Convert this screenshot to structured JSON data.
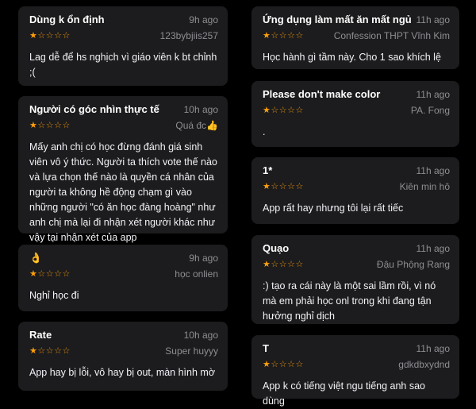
{
  "reviews_left": [
    {
      "title": "Dùng k ổn định",
      "time": "9h ago",
      "rating": 1,
      "author": "123bybjiis257",
      "body": "Lag dễ để hs nghịch vì giáo viên k bt chỉnh ;("
    },
    {
      "title": "Người có góc nhìn thực tế",
      "time": "10h ago",
      "rating": 1,
      "author": "Quá đc👍",
      "body": "Mấy anh chị có học đừng đánh giá sinh viên vô ý thức. Người ta thích vote thế nào và lựa chọn thế nào là quyền cá nhân của người ta không hề động chạm gì vào những người \"có ăn học đàng hoàng\" như anh chị mà lại đi nhận xét người khác như vậy tại nhận xét của app"
    },
    {
      "title": "👌",
      "time": "9h ago",
      "rating": 1,
      "author": "học onlien",
      "body": "Nghỉ học đi"
    },
    {
      "title": "Rate",
      "time": "10h ago",
      "rating": 1,
      "author": "Super huyyy",
      "body": "App hay bị lỗi, vô hay bị out, màn hình mờ"
    }
  ],
  "reviews_right": [
    {
      "title": "Ứng dụng làm mất ăn mất ngủ",
      "time": "11h ago",
      "rating": 1,
      "author": "Confession THPT Vĩnh Kim",
      "body": "Học hành gì tầm này. Cho 1 sao khích lệ"
    },
    {
      "title": "Please don't make color",
      "time": "11h ago",
      "rating": 1,
      "author": "PA. Fong",
      "body": "."
    },
    {
      "title": "1*",
      "time": "11h ago",
      "rating": 1,
      "author": "Kiên min hô",
      "body": "App rất hay nhưng tôi lại rất tiếc"
    },
    {
      "title": "Quạo",
      "time": "11h ago",
      "rating": 1,
      "author": "Đậu Phộng Rang",
      "body": ":) tạo ra cái này là một sai lầm rồi, vì nó mà em phải học onl trong khi đang tận hưởng nghỉ dịch"
    },
    {
      "title": "T",
      "time": "11h ago",
      "rating": 1,
      "author": "gdkdbxydnd",
      "body": "App k có tiếng việt ngu tiếng anh sao dùng"
    }
  ],
  "rating_max": 5,
  "colors": {
    "star": "#ff9f0a",
    "card": "#1c1c1e",
    "muted": "#8e8e93"
  }
}
